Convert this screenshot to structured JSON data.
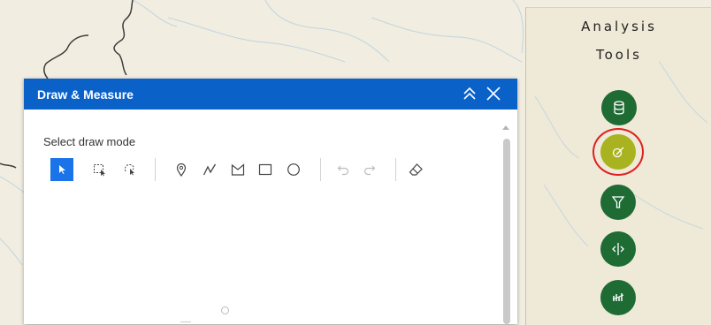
{
  "draw_panel": {
    "title": "Draw & Measure",
    "select_label": "Select draw mode",
    "tools": [
      {
        "name": "select-tool",
        "icon": "pointer-icon",
        "active": true
      },
      {
        "name": "rectangle-select-tool",
        "icon": "rectangle-select-icon"
      },
      {
        "name": "lasso-select-tool",
        "icon": "lasso-select-icon"
      },
      {
        "name": "point-tool",
        "icon": "map-pin-icon"
      },
      {
        "name": "polyline-tool",
        "icon": "polyline-icon"
      },
      {
        "name": "polygon-tool",
        "icon": "polygon-icon"
      },
      {
        "name": "rectangle-tool",
        "icon": "rectangle-icon"
      },
      {
        "name": "circle-tool",
        "icon": "circle-icon"
      },
      {
        "name": "undo-tool",
        "icon": "undo-icon",
        "disabled": true
      },
      {
        "name": "redo-tool",
        "icon": "redo-icon",
        "disabled": true
      },
      {
        "name": "clear-tool",
        "icon": "eraser-icon"
      }
    ]
  },
  "analysis_panel": {
    "title_line1": "Analysis",
    "title_line2": "Tools",
    "buttons": [
      {
        "name": "database-tool-button",
        "icon": "database-icon",
        "color": "#1e6b34"
      },
      {
        "name": "draw-measure-tool-button",
        "icon": "draw-measure-icon",
        "color": "#a9b21f",
        "highlighted": true
      },
      {
        "name": "filter-tool-button",
        "icon": "filter-icon",
        "color": "#1e6b34"
      },
      {
        "name": "swipe-tool-button",
        "icon": "swipe-icon",
        "color": "#1e6b34"
      },
      {
        "name": "chart-tool-button",
        "icon": "chart-icon",
        "color": "#1e6b34"
      }
    ]
  },
  "colors": {
    "header_blue": "#0a62c9",
    "active_tool": "#1a73e8",
    "tool_green": "#1e6b34",
    "tool_active_yellow": "#a9b21f",
    "highlight_red": "#e02020"
  }
}
